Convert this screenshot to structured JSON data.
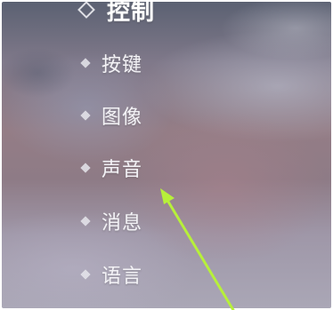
{
  "menu": {
    "header": "控制",
    "items": [
      {
        "label": "按键"
      },
      {
        "label": "图像"
      },
      {
        "label": "声音"
      },
      {
        "label": "消息"
      },
      {
        "label": "语言"
      }
    ]
  },
  "colors": {
    "arrow": "#b7f03a",
    "text": "#f3f2f6"
  }
}
